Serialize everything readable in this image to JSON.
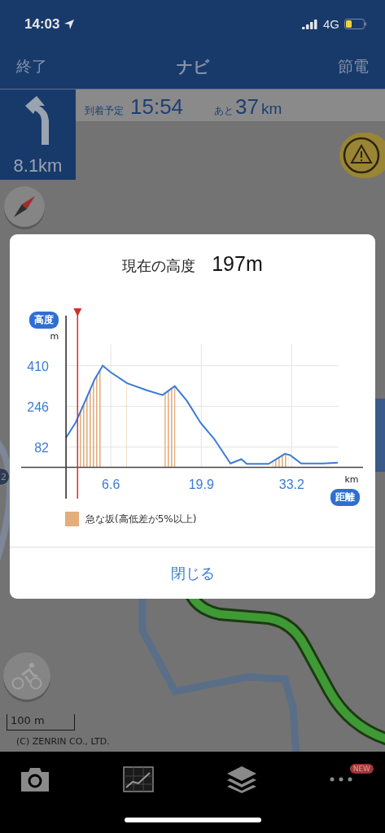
{
  "status_bar": {
    "time": "14:03",
    "network": "4G"
  },
  "nav_bar": {
    "left": "終了",
    "title": "ナビ",
    "right": "節電"
  },
  "guidance": {
    "distance": "8.1km",
    "eta_label": "到着予定",
    "eta": "15:54",
    "remaining_label": "あと",
    "remaining": "37",
    "remaining_unit": "km"
  },
  "map": {
    "kind": "picture",
    "route_marker": "2",
    "scale": "100 m",
    "copyright": "(C) ZENRIN CO., LTD."
  },
  "dialog": {
    "title": "現在の高度",
    "value": "197m",
    "y_unit": "m",
    "x_unit": "km",
    "legend": "急な坂(高低差が5%以上)",
    "close": "閉じる",
    "chart_data": {
      "type": "line",
      "xlabel": "距離",
      "ylabel": "高度",
      "xlim": [
        -6.6,
        43.7
      ],
      "ylim": [
        -126,
        612
      ],
      "xticks": [
        6.6,
        19.9,
        33.2
      ],
      "yticks": [
        82,
        246,
        410
      ],
      "x": [
        0,
        1.4,
        3.0,
        4.2,
        5.4,
        6.6,
        9.0,
        11.8,
        14.2,
        16.0,
        17.8,
        19.8,
        21.8,
        24.2,
        25.8,
        26.6,
        29.8,
        32.2,
        33.0,
        34.6,
        37.8,
        40.0
      ],
      "series": [
        {
          "color": "#3a7bd5",
          "values": [
            120,
            180,
            279,
            355,
            410,
            383,
            339,
            312,
            292,
            328,
            268,
            180,
            115,
            16,
            33,
            14,
            14,
            55,
            49,
            16,
            16,
            19
          ]
        }
      ]
    }
  },
  "tab_bar": {
    "badge": "NEW"
  }
}
